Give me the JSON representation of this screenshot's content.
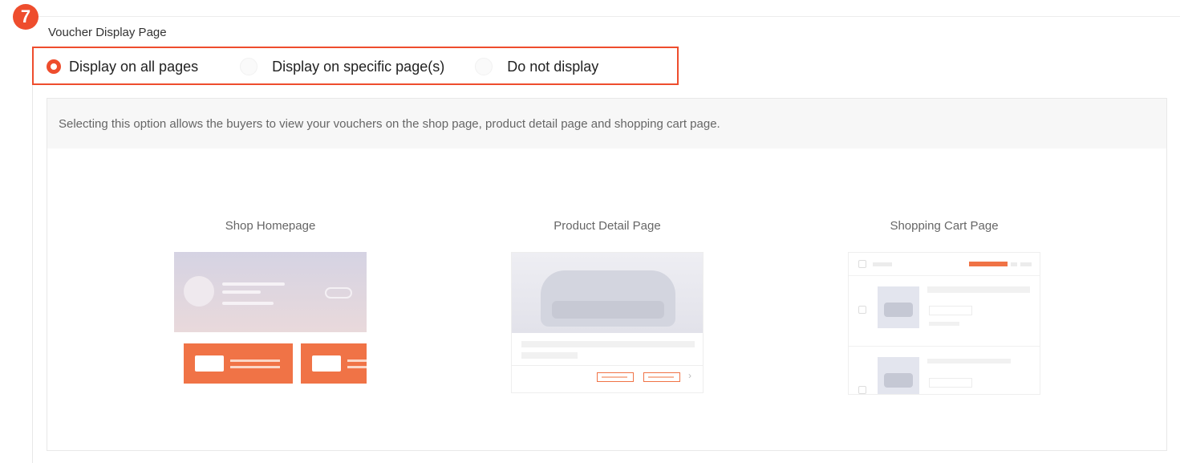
{
  "step_badge": "7",
  "section": {
    "title": "Voucher Display Page"
  },
  "radio_options": [
    {
      "label": "Display on all pages",
      "checked": true
    },
    {
      "label": "Display on specific page(s)",
      "checked": false
    },
    {
      "label": "Do not display",
      "checked": false
    }
  ],
  "panel": {
    "description": "Selecting this option allows the buyers to view your vouchers on the shop page, product detail page and shopping cart page.",
    "previews": [
      {
        "caption": "Shop Homepage"
      },
      {
        "caption": "Product Detail Page"
      },
      {
        "caption": "Shopping Cart Page"
      }
    ]
  },
  "colors": {
    "accent": "#ee4d2d",
    "voucher": "#f07346"
  }
}
